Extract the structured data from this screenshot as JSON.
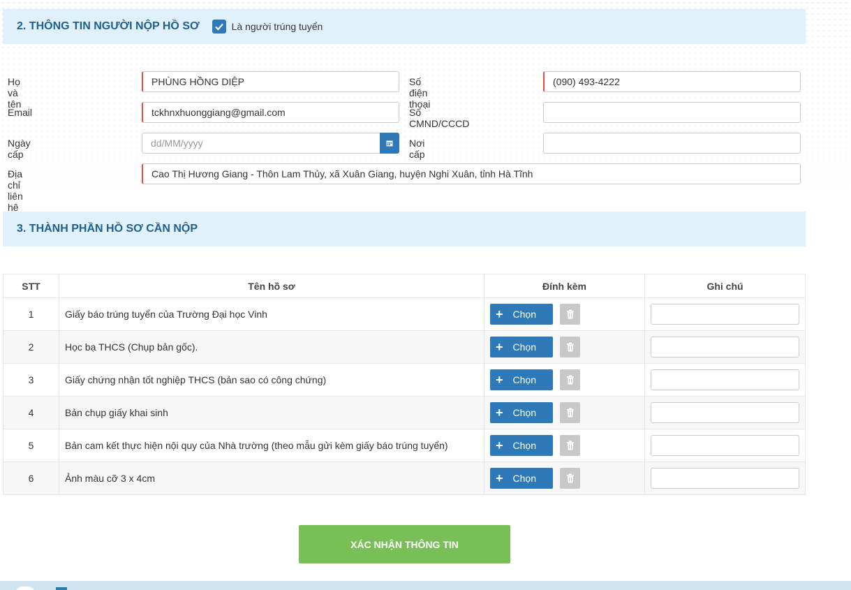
{
  "section2": {
    "title": "2. THÔNG TIN NGƯỜI NỘP HỒ SƠ",
    "checkbox_label": "Là người trúng tuyển",
    "checkbox_checked": true
  },
  "form": {
    "ho_ten_label": "Họ và tên",
    "ho_ten_value": "PHÙNG HỒNG DIỆP",
    "sdt_label": "Số điện thoại",
    "sdt_value": "(090) 493-4222",
    "email_label": "Email",
    "email_value": "tckhnxhuonggiang@gmail.com",
    "cmnd_label": "Số CMND/CCCD",
    "cmnd_value": "",
    "ngay_cap_label": "Ngày cấp",
    "ngay_cap_placeholder": "dd/MM/yyyy",
    "noi_cap_label": "Nơi cấp",
    "noi_cap_value": "",
    "dia_chi_label": "Địa chỉ liên hệ",
    "dia_chi_value": "Cao Thị Hương Giang - Thôn Lam Thủy, xã Xuân Giang, huyện Nghi Xuân, tỉnh Hà Tĩnh"
  },
  "section3": {
    "title": "3. THÀNH PHẦN HỒ SƠ CẦN NỘP"
  },
  "table": {
    "headers": [
      "STT",
      "Tên hồ sơ",
      "Đính kèm",
      "Ghi chú"
    ],
    "choose_label": "Chọn",
    "rows": [
      {
        "stt": "1",
        "name": "Giấy báo trúng tuyển của Trường Đại học Vinh"
      },
      {
        "stt": "2",
        "name": "Học bạ THCS (Chụp bản gốc)."
      },
      {
        "stt": "3",
        "name": "Giấy chứng nhận tốt nghiệp THCS (bản sao có công chứng)"
      },
      {
        "stt": "4",
        "name": "Bản chụp giấy khai sinh"
      },
      {
        "stt": "5",
        "name": "Bản cam kết thực hiện nội quy của Nhà trường (theo mẫu gửi kèm giấy báo trúng tuyển)"
      },
      {
        "stt": "6",
        "name": "Ảnh màu cỡ 3 x 4cm"
      }
    ]
  },
  "confirm_button": "XÁC NHẬN THÔNG TIN",
  "colors": {
    "primary": "#2e7ab8",
    "header_bg": "#e0f1fc",
    "confirm": "#78bf57",
    "required": "#e74c3c"
  }
}
